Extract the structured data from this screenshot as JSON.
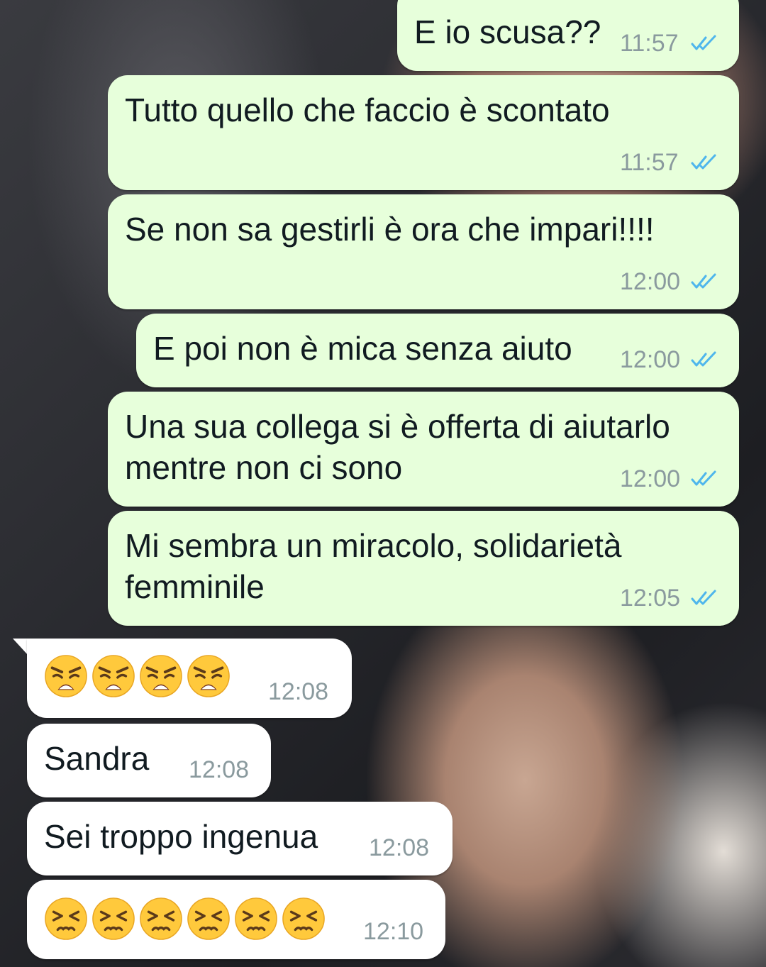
{
  "messages": [
    {
      "text": "E io scusa??",
      "time": "11:57",
      "status": "read"
    },
    {
      "text": "Tutto quello che faccio è scontato",
      "time": "11:57",
      "status": "read"
    },
    {
      "text": "Se non sa gestirli è ora che impari!!!!",
      "time": "12:00",
      "status": "read"
    },
    {
      "text": "E poi non è mica senza aiuto",
      "time": "12:00",
      "status": "read"
    },
    {
      "line1": "Una sua collega si è offerta di aiutarlo",
      "line2": "mentre non ci sono",
      "time": "12:00",
      "status": "read"
    },
    {
      "line1": "Mi sembra un miracolo, solidarietà",
      "line2": "femminile",
      "time": "12:05",
      "status": "read"
    },
    {
      "emoji": "weary-face",
      "count": 4,
      "time": "12:08"
    },
    {
      "text": "Sandra",
      "time": "12:08"
    },
    {
      "text": "Sei troppo ingenua",
      "time": "12:08"
    },
    {
      "emoji": "persevering-face",
      "count": 6,
      "time": "12:10"
    }
  ],
  "colors": {
    "outgoing_bubble": "#e7ffdb",
    "incoming_bubble": "#ffffff",
    "read_ticks": "#4fb6ec",
    "time_text": "#8a9a9e",
    "emoji_yellow": "#ffc93c"
  }
}
